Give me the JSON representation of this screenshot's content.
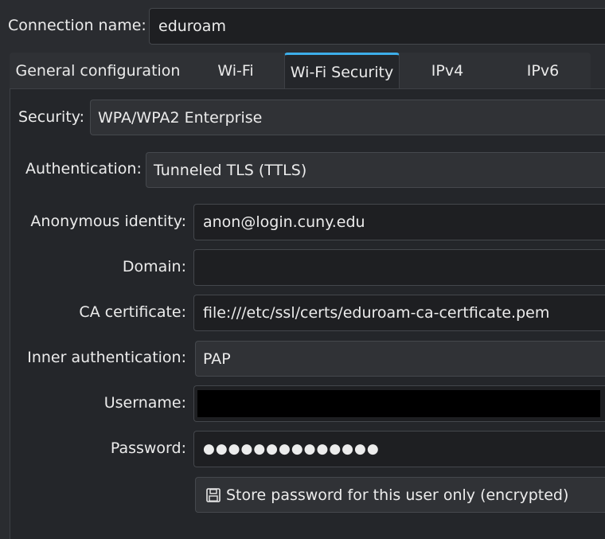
{
  "connection": {
    "label": "Connection name:",
    "value": "eduroam"
  },
  "tabs": [
    {
      "label": "General configuration",
      "active": false
    },
    {
      "label": "Wi-Fi",
      "active": false
    },
    {
      "label": "Wi-Fi Security",
      "active": true
    },
    {
      "label": "IPv4",
      "active": false
    },
    {
      "label": "IPv6",
      "active": false
    }
  ],
  "security": {
    "label": "Security:",
    "value": "WPA/WPA2 Enterprise"
  },
  "authentication": {
    "label": "Authentication:",
    "value": "Tunneled TLS (TTLS)"
  },
  "anonymous_identity": {
    "label": "Anonymous identity:",
    "value": "anon@login.cuny.edu"
  },
  "domain": {
    "label": "Domain:",
    "value": ""
  },
  "ca_certificate": {
    "label": "CA certificate:",
    "value": "file:///etc/ssl/certs/eduroam-ca-certficate.pem"
  },
  "inner_authentication": {
    "label": "Inner authentication:",
    "value": "PAP"
  },
  "username": {
    "label": "Username:",
    "value": ""
  },
  "password": {
    "label": "Password:",
    "value": "●●●●●●●●●●●●●●"
  },
  "store_password": {
    "label": "Store password for this user only (encrypted)",
    "icon": "save-icon"
  },
  "colors": {
    "accent": "#3daee9",
    "background": "#2a2c30"
  }
}
